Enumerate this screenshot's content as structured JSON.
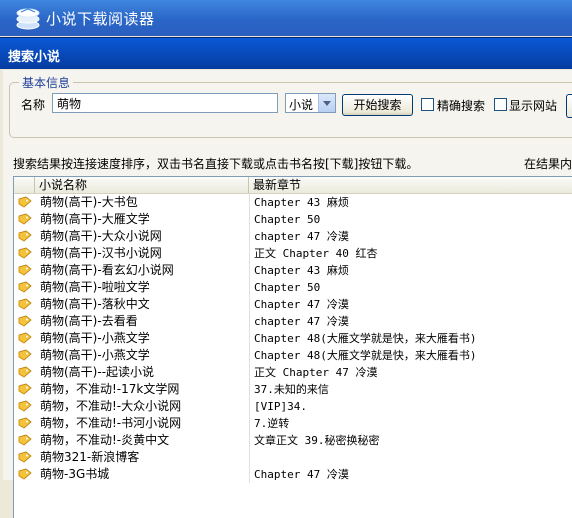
{
  "app": {
    "title": "小说下载阅读器"
  },
  "dialog": {
    "title": "搜索小说"
  },
  "basic_info": {
    "legend": "基本信息",
    "name_label": "名称",
    "name_value": "萌物",
    "type_select": "小说",
    "search_button": "开始搜索",
    "exact_search_label": "精确搜索",
    "exact_search_checked": false,
    "show_site_label": "显示网站",
    "show_site_checked": false
  },
  "hint": {
    "text": "搜索结果按连接速度排序，双击书名直接下载或点击书名按[下载]按钮下载。",
    "right_text": "在结果内"
  },
  "table": {
    "columns": [
      "小说名称",
      "最新章节"
    ],
    "rows": [
      {
        "name": "萌物(高干)-大书包",
        "chapter": "Chapter 43 麻烦"
      },
      {
        "name": "萌物(高干)-大雁文学",
        "chapter": "Chapter 50"
      },
      {
        "name": "萌物(高干)-大众小说网",
        "chapter": "chapter 47 冷漠"
      },
      {
        "name": "萌物(高干)-汉书小说网",
        "chapter": "正文 Chapter 40 红杏"
      },
      {
        "name": "萌物(高干)-看玄幻小说网",
        "chapter": "Chapter 43 麻烦"
      },
      {
        "name": "萌物(高干)-啦啦文学",
        "chapter": "Chapter 50"
      },
      {
        "name": "萌物(高干)-落秋中文",
        "chapter": "Chapter 47 冷漠"
      },
      {
        "name": "萌物(高干)-去看看",
        "chapter": "chapter 47 冷漠"
      },
      {
        "name": "萌物(高干)-小燕文学",
        "chapter": "Chapter 48(大雁文学就是快，来大雁看书)"
      },
      {
        "name": "萌物(高干)-小燕文学",
        "chapter": "Chapter 48(大雁文学就是快，来大雁看书)"
      },
      {
        "name": "萌物(高干)--起读小说",
        "chapter": "正文 Chapter 47 冷漠"
      },
      {
        "name": "萌物，不准动!-17k文学网",
        "chapter": "37.未知的来信"
      },
      {
        "name": "萌物，不准动!-大众小说网",
        "chapter": "[VIP]34."
      },
      {
        "name": "萌物，不准动!-书河小说网",
        "chapter": "7.逆转"
      },
      {
        "name": "萌物，不准动!-炎黄中文",
        "chapter": "文章正文 39.秘密换秘密"
      },
      {
        "name": "萌物321-新浪博客",
        "chapter": ""
      },
      {
        "name": "萌物-3G书城",
        "chapter": "Chapter 47 冷漠"
      }
    ]
  },
  "colors": {
    "titlebar_blue": "#0a58d6",
    "app_bar_blue": "#3f86de",
    "legend_blue": "#1e3f9a",
    "row_icon_yellow": "#f5c33b"
  },
  "icons": {
    "app_logo": "book-stack-icon",
    "row_icon": "book-tag-icon"
  }
}
